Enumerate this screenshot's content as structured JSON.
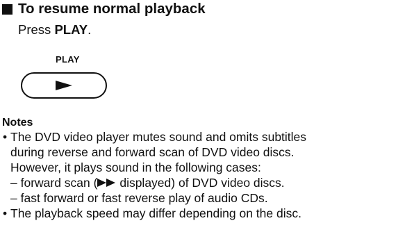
{
  "section": {
    "heading": "To resume normal playback"
  },
  "instruction": {
    "prefix": "Press ",
    "button_name": "PLAY",
    "suffix": "."
  },
  "figure": {
    "label": "PLAY",
    "button_icon": "play-triangle-icon"
  },
  "notes": {
    "title": "Notes",
    "bullet_glyph": "•",
    "lines": [
      "The DVD video player mutes sound and omits subtitles",
      "during reverse and forward scan of DVD video discs.",
      "However, it plays sound in the following cases:",
      "– forward scan (",
      " displayed) of DVD video discs.",
      "– fast forward or fast reverse play of audio CDs.",
      "The playback speed may differ depending on the disc."
    ],
    "forward_scan_icon": "fast-forward-icon"
  }
}
